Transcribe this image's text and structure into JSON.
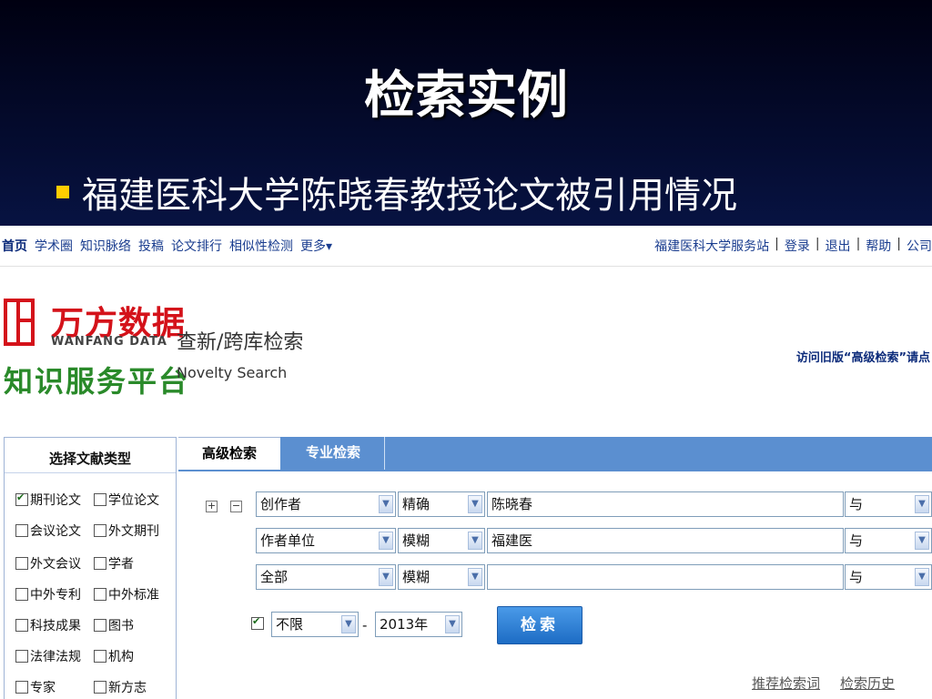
{
  "slide": {
    "title": "检索实例",
    "bullet": "福建医科大学陈晓春教授论文被引用情况"
  },
  "topnav": {
    "home": "首页",
    "items": [
      "学术圈",
      "知识脉络",
      "投稿",
      "论文排行",
      "相似性检测",
      "更多▾"
    ],
    "right": [
      "福建医科大学服务站",
      "登录",
      "退出",
      "帮助",
      "公司"
    ]
  },
  "header": {
    "logo_cn": "万方数据",
    "logo_en": "WANFANG DATA",
    "platform": "知识服务平台",
    "novelty_cn": "查新/跨库检索",
    "novelty_en": "Novelty Search",
    "old_link": "访问旧版“高级检索”请点"
  },
  "sidebar": {
    "title": "选择文献类型",
    "items": [
      {
        "label": "期刊论文",
        "checked": true
      },
      {
        "label": "学位论文",
        "checked": false
      },
      {
        "label": "会议论文",
        "checked": false
      },
      {
        "label": "外文期刊",
        "checked": false
      },
      {
        "label": "外文会议",
        "checked": false
      },
      {
        "label": "学者",
        "checked": false
      },
      {
        "label": "中外专利",
        "checked": false
      },
      {
        "label": "中外标准",
        "checked": false
      },
      {
        "label": "科技成果",
        "checked": false
      },
      {
        "label": "图书",
        "checked": false
      },
      {
        "label": "法律法规",
        "checked": false
      },
      {
        "label": "机构",
        "checked": false
      },
      {
        "label": "专家",
        "checked": false
      },
      {
        "label": "新方志",
        "checked": false
      }
    ]
  },
  "tabs": {
    "advanced": "高级检索",
    "professional": "专业检索"
  },
  "search": {
    "plus": "+",
    "minus": "−",
    "rows": [
      {
        "field": "创作者",
        "match": "精确",
        "value": "陈晓春",
        "logic": "与"
      },
      {
        "field": "作者单位",
        "match": "模糊",
        "value": "福建医",
        "logic": "与"
      },
      {
        "field": "全部",
        "match": "模糊",
        "value": "",
        "logic": "与"
      }
    ],
    "year_from": "不限",
    "year_sep": "-",
    "year_to": "2013年",
    "button": "检索"
  },
  "bottom_links": [
    "推荐检索词",
    "检索历史"
  ],
  "colors": {
    "slide_bg": "#0d2a8a",
    "tab_bar": "#5b8fd0",
    "button": "#1d6cc4",
    "logo_red": "#d4121a",
    "platform_green": "#2a8a2a"
  }
}
